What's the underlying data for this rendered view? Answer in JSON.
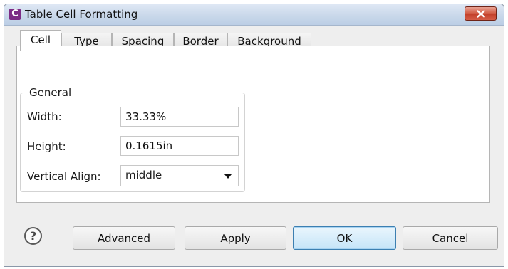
{
  "window": {
    "app_icon_letter": "C",
    "title": "Table Cell Formatting"
  },
  "tabs": [
    {
      "label": "Cell",
      "active": true
    },
    {
      "label": "Type",
      "active": false
    },
    {
      "label": "Spacing",
      "active": false
    },
    {
      "label": "Border",
      "active": false
    },
    {
      "label": "Background",
      "active": false
    }
  ],
  "general": {
    "title": "General",
    "width_label": "Width:",
    "width_value": "33.33%",
    "height_label": "Height:",
    "height_value": "0.1615in",
    "valign_label": "Vertical Align:",
    "valign_value": "middle"
  },
  "buttons": {
    "help": "?",
    "advanced": "Advanced",
    "apply": "Apply",
    "ok": "OK",
    "cancel": "Cancel"
  },
  "colors": {
    "app_icon": "#7c2c86",
    "close_button": "#c9452f",
    "default_button_border": "#3c7fb1"
  }
}
